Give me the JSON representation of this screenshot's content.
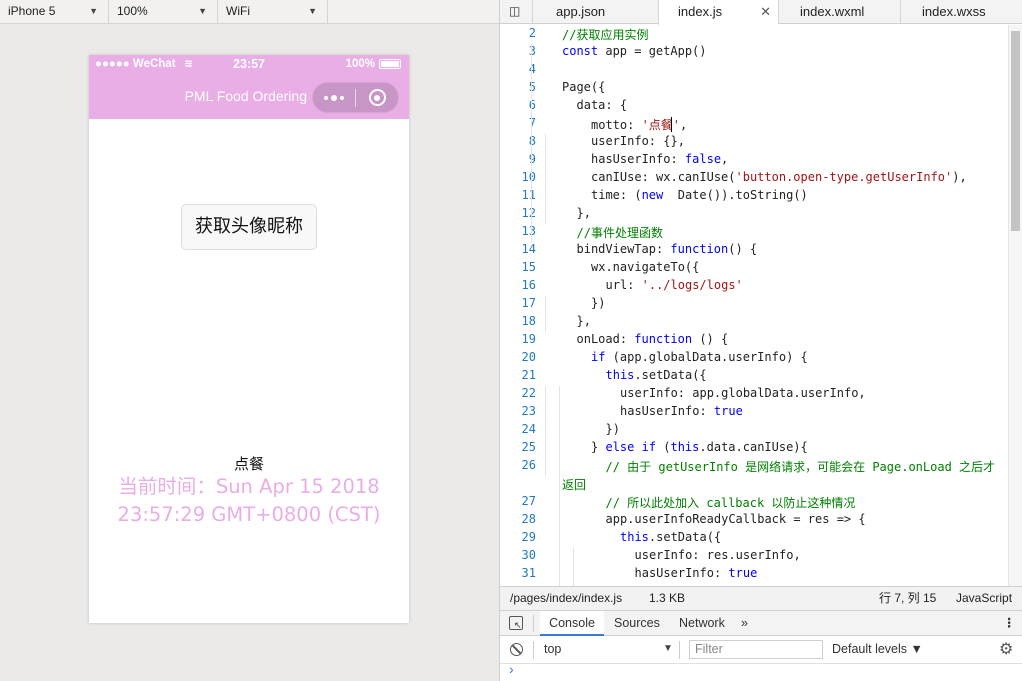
{
  "sim_toolbar": {
    "device": "iPhone 5",
    "zoom": "100%",
    "network": "WiFi"
  },
  "status_bar": {
    "carrier": "●●●●● WeChat",
    "time": "23:57",
    "battery": "100%"
  },
  "nav": {
    "title": "PML Food Ordering"
  },
  "page": {
    "avatar_button": "获取头像昵称",
    "motto": "点餐",
    "time_line1": "当前时间：Sun Apr 15 2018",
    "time_line2": "23:57:29 GMT+0800 (CST)"
  },
  "accent": {
    "nav_color": "#e8aee5",
    "time_color": "#e8aee5"
  },
  "tabs": [
    {
      "label": "app.json"
    },
    {
      "label": "index.js"
    },
    {
      "label": "index.wxml"
    },
    {
      "label": "index.wxss"
    }
  ],
  "code_lines": [
    {
      "n": "2",
      "ind": 0,
      "t": [
        [
          "c",
          "//获取应用实例"
        ]
      ]
    },
    {
      "n": "3",
      "ind": 0,
      "t": [
        [
          "k",
          "const"
        ],
        [
          "",
          "app = getApp()"
        ]
      ]
    },
    {
      "n": "4",
      "ind": 0,
      "t": []
    },
    {
      "n": "5",
      "ind": 0,
      "t": [
        [
          "",
          "Page({"
        ]
      ]
    },
    {
      "n": "6",
      "ind": 1,
      "t": [
        [
          "",
          "data: {"
        ]
      ]
    },
    {
      "n": "7",
      "ind": 2,
      "t": [
        [
          "",
          "motto: "
        ],
        [
          "s",
          "'点餐'"
        ],
        [
          "",
          ","
        ]
      ]
    },
    {
      "n": "8",
      "ind": 2,
      "t": [
        [
          "",
          "userInfo: {},"
        ]
      ]
    },
    {
      "n": "9",
      "ind": 2,
      "t": [
        [
          "",
          "hasUserInfo: "
        ],
        [
          "k",
          "false"
        ],
        [
          "",
          ","
        ]
      ]
    },
    {
      "n": "10",
      "ind": 2,
      "t": [
        [
          "",
          "canIUse: wx.canIUse("
        ],
        [
          "s",
          "'button.open-type.getUserInfo'"
        ],
        [
          "",
          "),"
        ]
      ]
    },
    {
      "n": "11",
      "ind": 2,
      "t": [
        [
          "",
          "time: ("
        ],
        [
          "k",
          "new"
        ],
        [
          "",
          " Date()).toString()"
        ]
      ]
    },
    {
      "n": "12",
      "ind": 1,
      "t": [
        [
          "",
          "},"
        ]
      ]
    },
    {
      "n": "13",
      "ind": 1,
      "t": [
        [
          "c",
          "//事件处理函数"
        ]
      ]
    },
    {
      "n": "14",
      "ind": 1,
      "t": [
        [
          "",
          "bindViewTap: "
        ],
        [
          "k",
          "function"
        ],
        [
          "",
          "() {"
        ]
      ]
    },
    {
      "n": "15",
      "ind": 2,
      "t": [
        [
          "",
          "wx.navigateTo({"
        ]
      ]
    },
    {
      "n": "16",
      "ind": 3,
      "t": [
        [
          "",
          "url: "
        ],
        [
          "s",
          "'../logs/logs'"
        ]
      ]
    },
    {
      "n": "17",
      "ind": 2,
      "t": [
        [
          "",
          "})"
        ]
      ]
    },
    {
      "n": "18",
      "ind": 1,
      "t": [
        [
          "",
          "},"
        ]
      ]
    },
    {
      "n": "19",
      "ind": 1,
      "t": [
        [
          "",
          "onLoad: "
        ],
        [
          "k",
          "function"
        ],
        [
          "",
          " () {"
        ]
      ]
    },
    {
      "n": "20",
      "ind": 2,
      "t": [
        [
          "k",
          "if"
        ],
        [
          "",
          " (app.globalData.userInfo) {"
        ]
      ]
    },
    {
      "n": "21",
      "ind": 3,
      "t": [
        [
          "k",
          "this"
        ],
        [
          "",
          ".setData({"
        ]
      ]
    },
    {
      "n": "22",
      "ind": 4,
      "t": [
        [
          "",
          "userInfo: app.globalData.userInfo,"
        ]
      ]
    },
    {
      "n": "23",
      "ind": 4,
      "t": [
        [
          "",
          "hasUserInfo: "
        ],
        [
          "k",
          "true"
        ]
      ]
    },
    {
      "n": "24",
      "ind": 3,
      "t": [
        [
          "",
          "})"
        ]
      ]
    },
    {
      "n": "25",
      "ind": 2,
      "t": [
        [
          "",
          "} "
        ],
        [
          "k",
          "else if"
        ],
        [
          "",
          " ("
        ],
        [
          "k",
          "this"
        ],
        [
          "",
          ".data.canIUse){"
        ]
      ]
    },
    {
      "n": "26",
      "ind": 3,
      "t": [
        [
          "c",
          "// 由于 getUserInfo 是网络请求，可能会在 Page.onLoad 之后才"
        ]
      ]
    },
    {
      "n": "",
      "ind": 0,
      "t": [
        [
          "c",
          "返回"
        ]
      ]
    },
    {
      "n": "27",
      "ind": 3,
      "t": [
        [
          "c",
          "// 所以此处加入 callback 以防止这种情况"
        ]
      ]
    },
    {
      "n": "28",
      "ind": 3,
      "t": [
        [
          "",
          "app.userInfoReadyCallback = res => {"
        ]
      ]
    },
    {
      "n": "29",
      "ind": 4,
      "t": [
        [
          "k",
          "this"
        ],
        [
          "",
          ".setData({"
        ]
      ]
    },
    {
      "n": "30",
      "ind": 5,
      "t": [
        [
          "",
          "userInfo: res.userInfo,"
        ]
      ]
    },
    {
      "n": "31",
      "ind": 5,
      "t": [
        [
          "",
          "hasUserInfo: "
        ],
        [
          "k",
          "true"
        ]
      ]
    }
  ],
  "editor_status": {
    "path": "/pages/index/index.js",
    "size": "1.3 KB",
    "position": "行 7, 列 15",
    "language": "JavaScript"
  },
  "devtools": {
    "tabs": [
      "Console",
      "Sources",
      "Network"
    ],
    "more": "»",
    "context": "top",
    "filter_placeholder": "Filter",
    "levels": "Default levels ▼",
    "prompt": "›"
  }
}
